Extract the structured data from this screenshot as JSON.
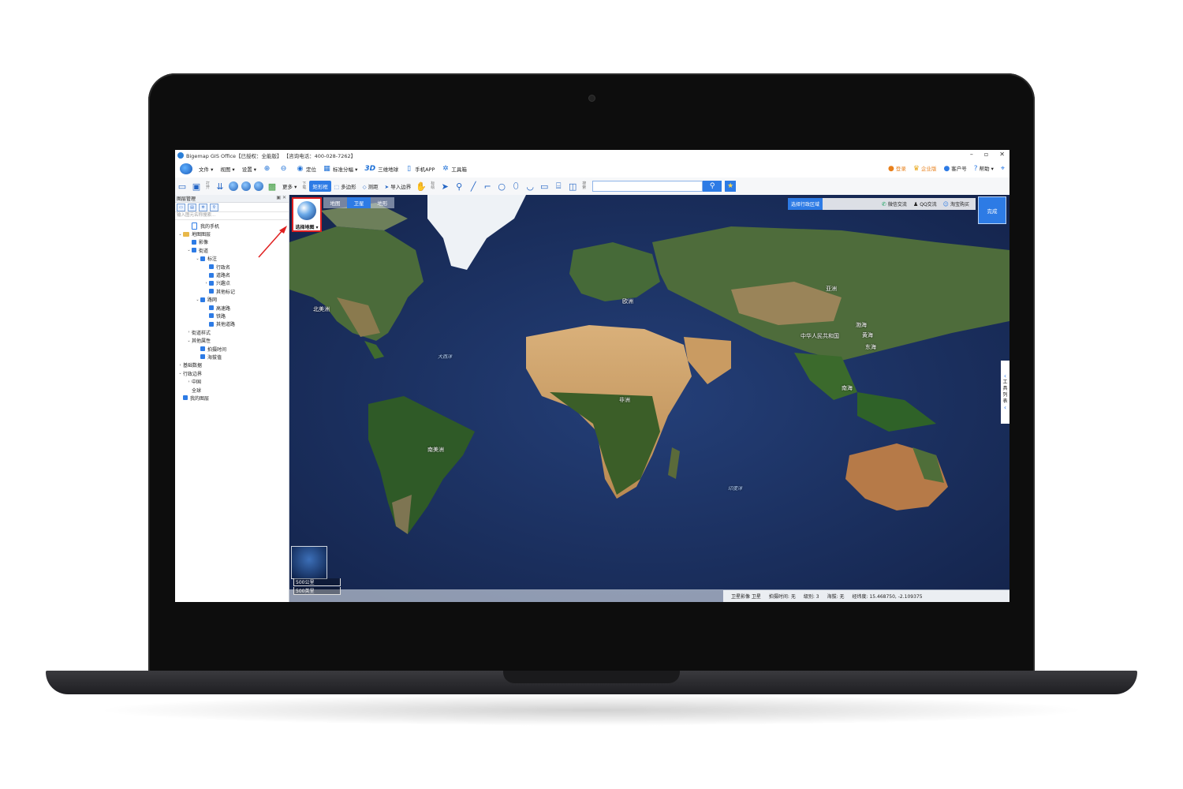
{
  "window": {
    "title": "Bigemap GIS Office【已授权：全能版】 【咨询电话：400-028-7262】",
    "controls": [
      "–",
      "▫",
      "✕"
    ]
  },
  "menu": {
    "items": [
      {
        "label": "文件 ▾",
        "icon": ""
      },
      {
        "label": "视图 ▾",
        "icon": ""
      },
      {
        "label": "设置 ▾",
        "icon": ""
      },
      {
        "label": "",
        "icon": "⊕"
      },
      {
        "label": "",
        "icon": "⊖"
      },
      {
        "label": "定位",
        "icon": "◉"
      },
      {
        "label": "标准分幅 ▾",
        "icon": "▦"
      },
      {
        "label": "三维地球",
        "icon": "3D"
      },
      {
        "label": "手机APP",
        "icon": "▯"
      },
      {
        "label": "工具箱",
        "icon": "✲"
      }
    ],
    "right": [
      {
        "label": "登录",
        "icon": "●"
      },
      {
        "label": "企业版",
        "icon": "♛"
      },
      {
        "label": "客户号",
        "icon": "●"
      },
      {
        "label": "帮助 ▾",
        "icon": "?"
      }
    ]
  },
  "toolbar": {
    "label_open": "打开",
    "label_down": "下载",
    "label_mark": "标绘",
    "label_search": "搜索",
    "more": "更多 ▾",
    "rect": "矩形框",
    "polygon": "多边形",
    "measure": "测距",
    "import": "导入边界"
  },
  "layer_panel": {
    "title": "图层管理",
    "search_placeholder": "输入图元名称搜索...",
    "rows": [
      {
        "label": "我的手机",
        "indent": 1,
        "type": "phone",
        "arrow": ""
      },
      {
        "label": "地图图层",
        "indent": 0,
        "type": "folder",
        "arrow": "⌄"
      },
      {
        "label": "影像",
        "indent": 1,
        "type": "cb",
        "arrow": ""
      },
      {
        "label": "街道",
        "indent": 1,
        "type": "cb",
        "arrow": "⌄"
      },
      {
        "label": "标注",
        "indent": 2,
        "type": "cb",
        "arrow": "⌄"
      },
      {
        "label": "行政名",
        "indent": 3,
        "type": "cb",
        "arrow": ""
      },
      {
        "label": "道路名",
        "indent": 3,
        "type": "cb",
        "arrow": ""
      },
      {
        "label": "兴趣点",
        "indent": 3,
        "type": "cb",
        "arrow": "›"
      },
      {
        "label": "其他标记",
        "indent": 3,
        "type": "cb",
        "arrow": ""
      },
      {
        "label": "路网",
        "indent": 2,
        "type": "cb",
        "arrow": "⌄"
      },
      {
        "label": "高速路",
        "indent": 3,
        "type": "cb",
        "arrow": ""
      },
      {
        "label": "铁路",
        "indent": 3,
        "type": "cb",
        "arrow": ""
      },
      {
        "label": "其他道路",
        "indent": 3,
        "type": "cb",
        "arrow": ""
      },
      {
        "label": "街道样式",
        "indent": 1,
        "type": "none",
        "arrow": "›"
      },
      {
        "label": "其他属性",
        "indent": 1,
        "type": "none",
        "arrow": "⌄"
      },
      {
        "label": "拍摄时间",
        "indent": 2,
        "type": "cb",
        "arrow": ""
      },
      {
        "label": "海拔值",
        "indent": 2,
        "type": "cb",
        "arrow": ""
      },
      {
        "label": "基础数据",
        "indent": 0,
        "type": "none",
        "arrow": "›"
      },
      {
        "label": "行政边界",
        "indent": 0,
        "type": "none",
        "arrow": "⌄"
      },
      {
        "label": "中国",
        "indent": 1,
        "type": "none",
        "arrow": "›"
      },
      {
        "label": "全球",
        "indent": 1,
        "type": "none",
        "arrow": ""
      },
      {
        "label": "我的图层",
        "indent": 0,
        "type": "cb",
        "arrow": ""
      }
    ]
  },
  "map": {
    "tabs": [
      "地图",
      "卫星",
      "地形"
    ],
    "active_tab": "卫星",
    "select_map": "选择地图 ▾",
    "region_button": "选择行政区域",
    "tags": [
      {
        "label": "微信交流",
        "icon": "✆"
      },
      {
        "label": "QQ交流",
        "icon": "♟"
      },
      {
        "label": "淘宝购买",
        "icon": "☺"
      }
    ],
    "done": "完成",
    "tools_side": [
      "工",
      "具",
      "列",
      "表"
    ],
    "labels": [
      {
        "text": "北美洲",
        "kind": "land"
      },
      {
        "text": "欧洲",
        "kind": "land"
      },
      {
        "text": "亚洲",
        "kind": "land"
      },
      {
        "text": "渤海",
        "kind": "land"
      },
      {
        "text": "黄海",
        "kind": "land"
      },
      {
        "text": "东海",
        "kind": "land"
      },
      {
        "text": "中华人民共和国",
        "kind": "land"
      },
      {
        "text": "南海",
        "kind": "land"
      },
      {
        "text": "非洲",
        "kind": "land"
      },
      {
        "text": "南美洲",
        "kind": "land"
      },
      {
        "text": "大西洋",
        "kind": "ocean"
      },
      {
        "text": "印度洋",
        "kind": "ocean"
      }
    ],
    "scale": [
      "500公里",
      "500英里"
    ],
    "status": {
      "source": "卫星影像 卫星",
      "date": "拍摄时间: 无",
      "level": "级别: 3",
      "altitude": "海拔: 无",
      "coords": "经纬度: 15.468750, -2.109375"
    }
  }
}
